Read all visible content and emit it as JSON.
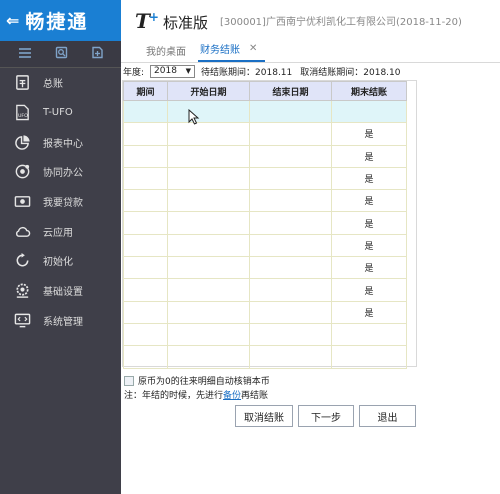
{
  "app": {
    "brand": "畅捷通",
    "logo_t": "T",
    "logo_plus": "+",
    "edition": "标准版",
    "company": "[300001]广西南宁优利凯化工有限公司",
    "date": "(2018-11-20)"
  },
  "sidebar": {
    "items": [
      {
        "label": "总账",
        "icon": "ledger-icon"
      },
      {
        "label": "T-UFO",
        "icon": "ufo-file-icon"
      },
      {
        "label": "报表中心",
        "icon": "pie-chart-icon"
      },
      {
        "label": "协同办公",
        "icon": "collaboration-icon"
      },
      {
        "label": "我要贷款",
        "icon": "cash-icon"
      },
      {
        "label": "云应用",
        "icon": "cloud-icon"
      },
      {
        "label": "初始化",
        "icon": "refresh-icon"
      },
      {
        "label": "基础设置",
        "icon": "settings-gear-icon"
      },
      {
        "label": "系统管理",
        "icon": "monitor-code-icon"
      }
    ]
  },
  "tabs": [
    {
      "label": "我的桌面"
    },
    {
      "label": "财务结账",
      "close": "✕"
    }
  ],
  "filter": {
    "year_label": "年度:",
    "year_value": "2018",
    "pending_label": "待结账期间：2018.11",
    "cancel_label": "取消结账期间：2018.10"
  },
  "table": {
    "headers": [
      "期间",
      "开始日期",
      "结束日期",
      "期末结账"
    ],
    "rows": [
      [
        "",
        "",
        "",
        ""
      ],
      [
        "",
        "",
        "",
        "是"
      ],
      [
        "",
        "",
        "",
        "是"
      ],
      [
        "",
        "",
        "",
        "是"
      ],
      [
        "",
        "",
        "",
        "是"
      ],
      [
        "",
        "",
        "",
        "是"
      ],
      [
        "",
        "",
        "",
        "是"
      ],
      [
        "",
        "",
        "",
        "是"
      ],
      [
        "",
        "",
        "",
        "是"
      ],
      [
        "",
        "",
        "",
        "是"
      ],
      [
        "",
        "",
        "",
        ""
      ],
      [
        "",
        "",
        "",
        ""
      ]
    ],
    "first_row_value": "是"
  },
  "footer": {
    "checkbox_label": "原币为0的往来明细自动核销本币",
    "note_prefix": "注：年结的时候，先进行",
    "note_link": "备份",
    "note_suffix": "再结账",
    "btn_cancel": "取消结账",
    "btn_next": "下一步",
    "btn_exit": "退出"
  },
  "colors": {
    "accent": "#1a7fd3",
    "sidebar_bg": "#3f3f49",
    "header_row_bg": "#e0e4f8",
    "selected_row_bg": "#dff5f9"
  }
}
